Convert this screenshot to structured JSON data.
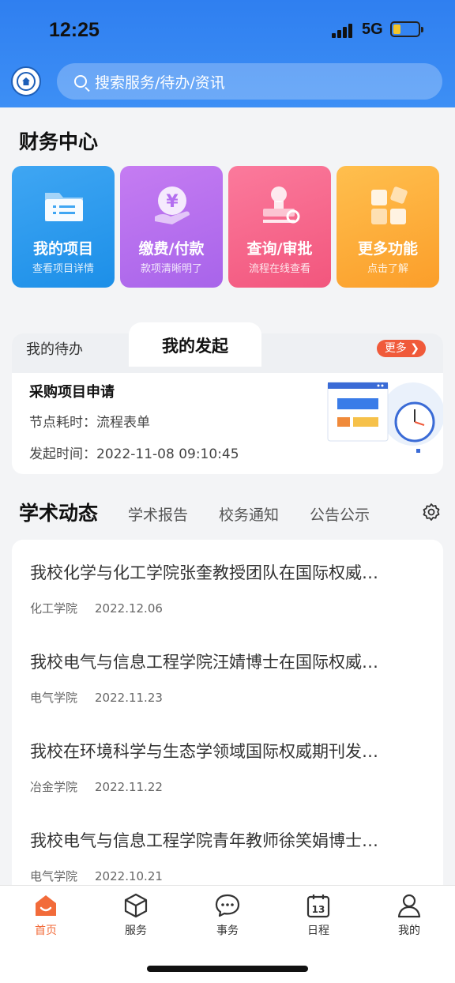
{
  "status": {
    "time": "12:25",
    "network": "5G"
  },
  "search": {
    "placeholder": "搜索服务/待办/资讯"
  },
  "finance": {
    "title": "财务中心",
    "tiles": [
      {
        "title": "我的项目",
        "subtitle": "查看项目详情",
        "icon": "folder-icon",
        "color": "#2a9aee"
      },
      {
        "title": "缴费/付款",
        "subtitle": "款项清晰明了",
        "icon": "yuan-hand-icon",
        "color": "#b46ff0"
      },
      {
        "title": "查询/审批",
        "subtitle": "流程在线查看",
        "icon": "stamp-icon",
        "color": "#f6668c"
      },
      {
        "title": "更多功能",
        "subtitle": "点击了解",
        "icon": "apps-grid-icon",
        "color": "#fdab3a"
      }
    ]
  },
  "tasks": {
    "tab_todo": "我的待办",
    "tab_initiated": "我的发起",
    "more": "更多",
    "item": {
      "title": "采购项目申请",
      "node_label": "节点耗时：",
      "node_value": "流程表单",
      "time_label": "发起时间：",
      "time_value": "2022-11-08 09:10:45"
    }
  },
  "news": {
    "title": "学术动态",
    "tabs": [
      "学术报告",
      "校务通知",
      "公告公示"
    ],
    "items": [
      {
        "title": "我校化学与化工学院张奎教授团队在国际权威…",
        "source": "化工学院",
        "date": "2022.12.06"
      },
      {
        "title": "我校电气与信息工程学院汪婧博士在国际权威…",
        "source": "电气学院",
        "date": "2022.11.23"
      },
      {
        "title": "我校在环境科学与生态学领域国际权威期刊发…",
        "source": "冶金学院",
        "date": "2022.11.22"
      },
      {
        "title": "我校电气与信息工程学院青年教师徐笑娟博士…",
        "source": "电气学院",
        "date": "2022.10.21"
      }
    ]
  },
  "nav": {
    "items": [
      {
        "label": "首页",
        "icon": "home-icon",
        "active": true
      },
      {
        "label": "服务",
        "icon": "cube-icon"
      },
      {
        "label": "事务",
        "icon": "chat-icon"
      },
      {
        "label": "日程",
        "icon": "calendar-icon",
        "day": "13"
      },
      {
        "label": "我的",
        "icon": "user-icon"
      }
    ],
    "active_color": "#f26b3a"
  },
  "colors": {
    "header": "#2f7ff0",
    "accent": "#f05a3a"
  }
}
